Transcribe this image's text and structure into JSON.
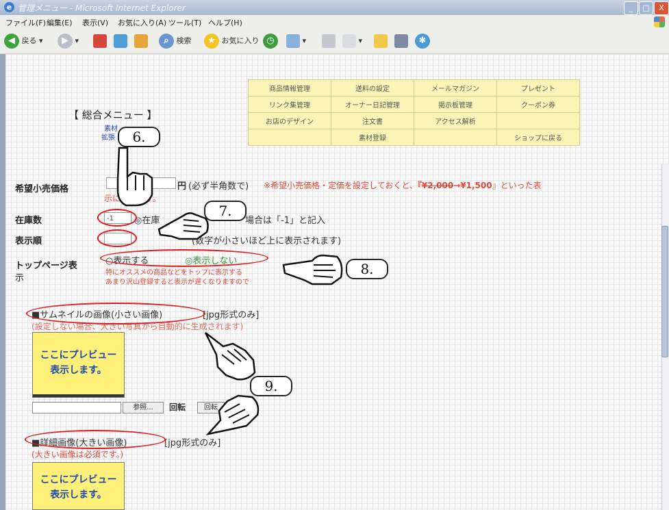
{
  "window": {
    "title": "管理メニュー - Microsoft Internet Explorer",
    "controls": [
      "_",
      "□",
      "X"
    ]
  },
  "menubar": [
    "ファイル(F)",
    "編集(E)",
    "表示(V)",
    "お気に入り(A)",
    "ツール(T)",
    "ヘルプ(H)"
  ],
  "toolbar": {
    "back": "戻る",
    "search": "検索",
    "favorites": "お気に入り"
  },
  "nav": {
    "rows": [
      [
        "商品情報管理",
        "送料の設定",
        "メールマガジン",
        "プレゼント"
      ],
      [
        "リンク集管理",
        "オーナー日記管理",
        "掲示板管理",
        "クーポン券"
      ],
      [
        "お店のデザイン",
        "注文書",
        "アクセス解析",
        ""
      ],
      [
        "",
        "素材登録",
        "",
        "ショップに戻る"
      ]
    ]
  },
  "menu_title": "【 総合メニュー 】",
  "sublinks": [
    "素材",
    "拡張"
  ],
  "form": {
    "price_label": "希望小売価格",
    "price_unit": "円",
    "price_note": "(必ず半角数で)",
    "price_warning_a": "※希望小売価格・定価を設定しておくと、",
    "price_warning_strike": "¥2,000",
    "price_warning_new": "→¥1,500",
    "price_warning_b": "』といった表",
    "price_warning_bracket": "『",
    "price_warning_cont": "示になります。",
    "stock_label": "在庫数",
    "stock_value": "-1",
    "stock_note_a": "◎在庫",
    "stock_note_b": "場合は「-1」と記入",
    "order_label": "表示順",
    "order_note": "(数字が小さいほど上に表示されます)",
    "top_label_a": "トップページ表",
    "top_label_b": "示",
    "top_opt_show": "○表示する",
    "top_opt_hide": "◎表示しない",
    "top_note_1": "特にオススメの商品などをトップに表示する",
    "top_note_2": "あまり沢山登録すると表示が遅くなりますので",
    "thumb_heading": "■サムネイルの画像(小さい画像)",
    "thumb_format": "[jpg形式のみ]",
    "thumb_note": "(設定しない場合、大きい写真から自動的に生成されます)",
    "preview_line1": "ここにプレビュー",
    "preview_line2": "表示します。",
    "browse_label": "参照...",
    "rotate_label": "回転",
    "rotate_btn": "回転",
    "detail_heading": "■詳細画像(大きい画像)",
    "detail_format": "[jpg形式のみ]",
    "detail_note": "(大きい画像は必須です。)"
  },
  "callouts": [
    "6.",
    "7.",
    "8.",
    "9."
  ]
}
